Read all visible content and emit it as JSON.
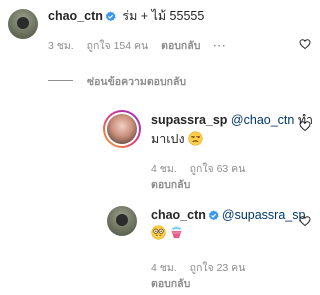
{
  "comments": [
    {
      "username": "chao_ctn",
      "text": " ร่ม + ไม้ 55555",
      "time": "3 ชม.",
      "likes": "ถูกใจ 154 คน",
      "reply": "ตอบกลับ",
      "more": "···"
    }
  ],
  "toggle_replies": "ซ่อนข้อความตอบกลับ",
  "replies": [
    {
      "username": "supassra_sp",
      "mention": "@chao_ctn",
      "text_line1": " ทำ",
      "text_line2": "มาเปง",
      "emojis": [
        "unamused-face"
      ],
      "time": "4 ชม.",
      "likes": "ถูกใจ 63 คน",
      "reply": "ตอบกลับ"
    },
    {
      "username": "chao_ctn",
      "mention": "@supassra_sp",
      "emojis": [
        "nerd-face",
        "shaved-ice"
      ],
      "time": "4 ชม.",
      "likes": "ถูกใจ 23 คน",
      "reply": "ตอบกลับ"
    }
  ],
  "colors": {
    "text": "#262626",
    "muted": "#8e8e8e",
    "mention": "#00376b",
    "verified": "#3897f0"
  }
}
